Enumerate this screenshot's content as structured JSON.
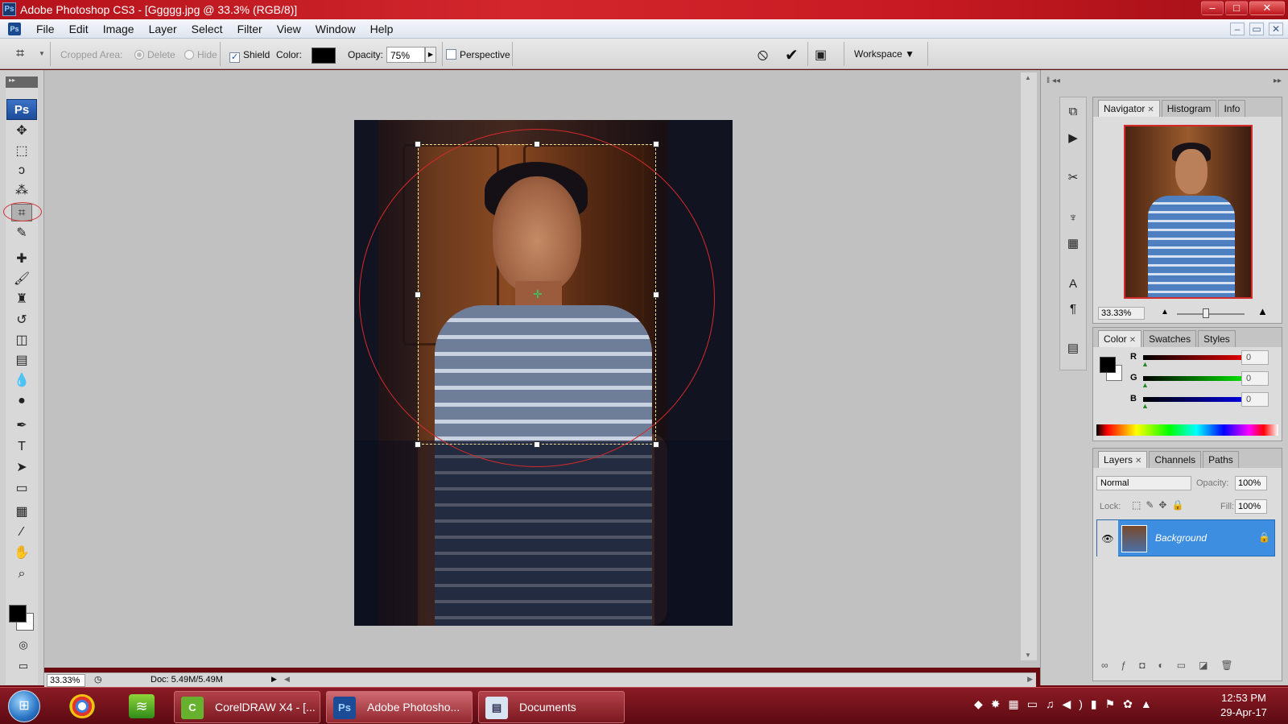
{
  "window": {
    "title": "Adobe Photoshop CS3 - [Ggggg.jpg @ 33.3% (RGB/8)]",
    "app_icon": "Ps",
    "buttons": {
      "minimize": "–",
      "maximize": "□",
      "close": "✕"
    }
  },
  "menubar": {
    "items": [
      "File",
      "Edit",
      "Image",
      "Layer",
      "Select",
      "Filter",
      "View",
      "Window",
      "Help"
    ],
    "doc_buttons": {
      "minimize": "–",
      "restore": "▭",
      "close": "✕"
    }
  },
  "options": {
    "tool_icon": "crop-icon",
    "cropped_area_label": "Cropped Area:",
    "delete_label": "Delete",
    "hide_label": "Hide",
    "shield_label": "Shield",
    "shield_checked": "✓",
    "color_label": "Color:",
    "opacity_label": "Opacity:",
    "opacity_value": "75%",
    "perspective_label": "Perspective",
    "workspace_label": "Workspace ▼"
  },
  "toolbox": {
    "badge": "Ps",
    "tools": [
      {
        "name": "move-tool-icon",
        "glyph": "✥"
      },
      {
        "name": "marquee-tool-icon",
        "glyph": "⬚"
      },
      {
        "name": "lasso-tool-icon",
        "glyph": "ↄ"
      },
      {
        "name": "magic-wand-tool-icon",
        "glyph": "⁂"
      },
      {
        "name": "crop-tool-icon",
        "glyph": "⌗"
      },
      {
        "name": "slice-tool-icon",
        "glyph": "✎"
      },
      {
        "name": "healing-brush-tool-icon",
        "glyph": "✚"
      },
      {
        "name": "brush-tool-icon",
        "glyph": "🖌"
      },
      {
        "name": "clone-stamp-tool-icon",
        "glyph": "♜"
      },
      {
        "name": "history-brush-tool-icon",
        "glyph": "↺"
      },
      {
        "name": "eraser-tool-icon",
        "glyph": "◫"
      },
      {
        "name": "gradient-tool-icon",
        "glyph": "▤"
      },
      {
        "name": "blur-tool-icon",
        "glyph": "💧"
      },
      {
        "name": "dodge-tool-icon",
        "glyph": "●"
      },
      {
        "name": "pen-tool-icon",
        "glyph": "✒"
      },
      {
        "name": "type-tool-icon",
        "glyph": "T"
      },
      {
        "name": "path-selection-tool-icon",
        "glyph": "➤"
      },
      {
        "name": "rectangle-tool-icon",
        "glyph": "▭"
      },
      {
        "name": "notes-tool-icon",
        "glyph": "▦"
      },
      {
        "name": "eyedropper-tool-icon",
        "glyph": "⁄"
      },
      {
        "name": "hand-tool-icon",
        "glyph": "✋"
      },
      {
        "name": "zoom-tool-icon",
        "glyph": "⌕"
      }
    ]
  },
  "statusbar": {
    "zoom": "33.33%",
    "doc_info": "Doc: 5.49M/5.49M"
  },
  "navigator": {
    "tabs": [
      "Navigator",
      "Histogram",
      "Info"
    ],
    "zoom": "33.33%"
  },
  "color_panel": {
    "tabs": [
      "Color",
      "Swatches",
      "Styles"
    ],
    "r_label": "R",
    "r_value": "0",
    "g_label": "G",
    "g_value": "0",
    "b_label": "B",
    "b_value": "0"
  },
  "layers_panel": {
    "tabs": [
      "Layers",
      "Channels",
      "Paths"
    ],
    "blend_mode": "Normal",
    "opacity_label": "Opacity:",
    "opacity_value": "100%",
    "lock_label": "Lock:",
    "fill_label": "Fill:",
    "fill_value": "100%",
    "layer_name": "Background"
  },
  "taskbar": {
    "tasks": [
      "CorelDRAW X4 - [...",
      "Adobe Photosho...",
      "Documents"
    ],
    "time": "12:53 PM",
    "date": "29-Apr-17"
  },
  "colors": {
    "titlebar": "#c81a22",
    "selection_ring": "#d42a2a",
    "layer_selected": "#3d8ee0"
  }
}
